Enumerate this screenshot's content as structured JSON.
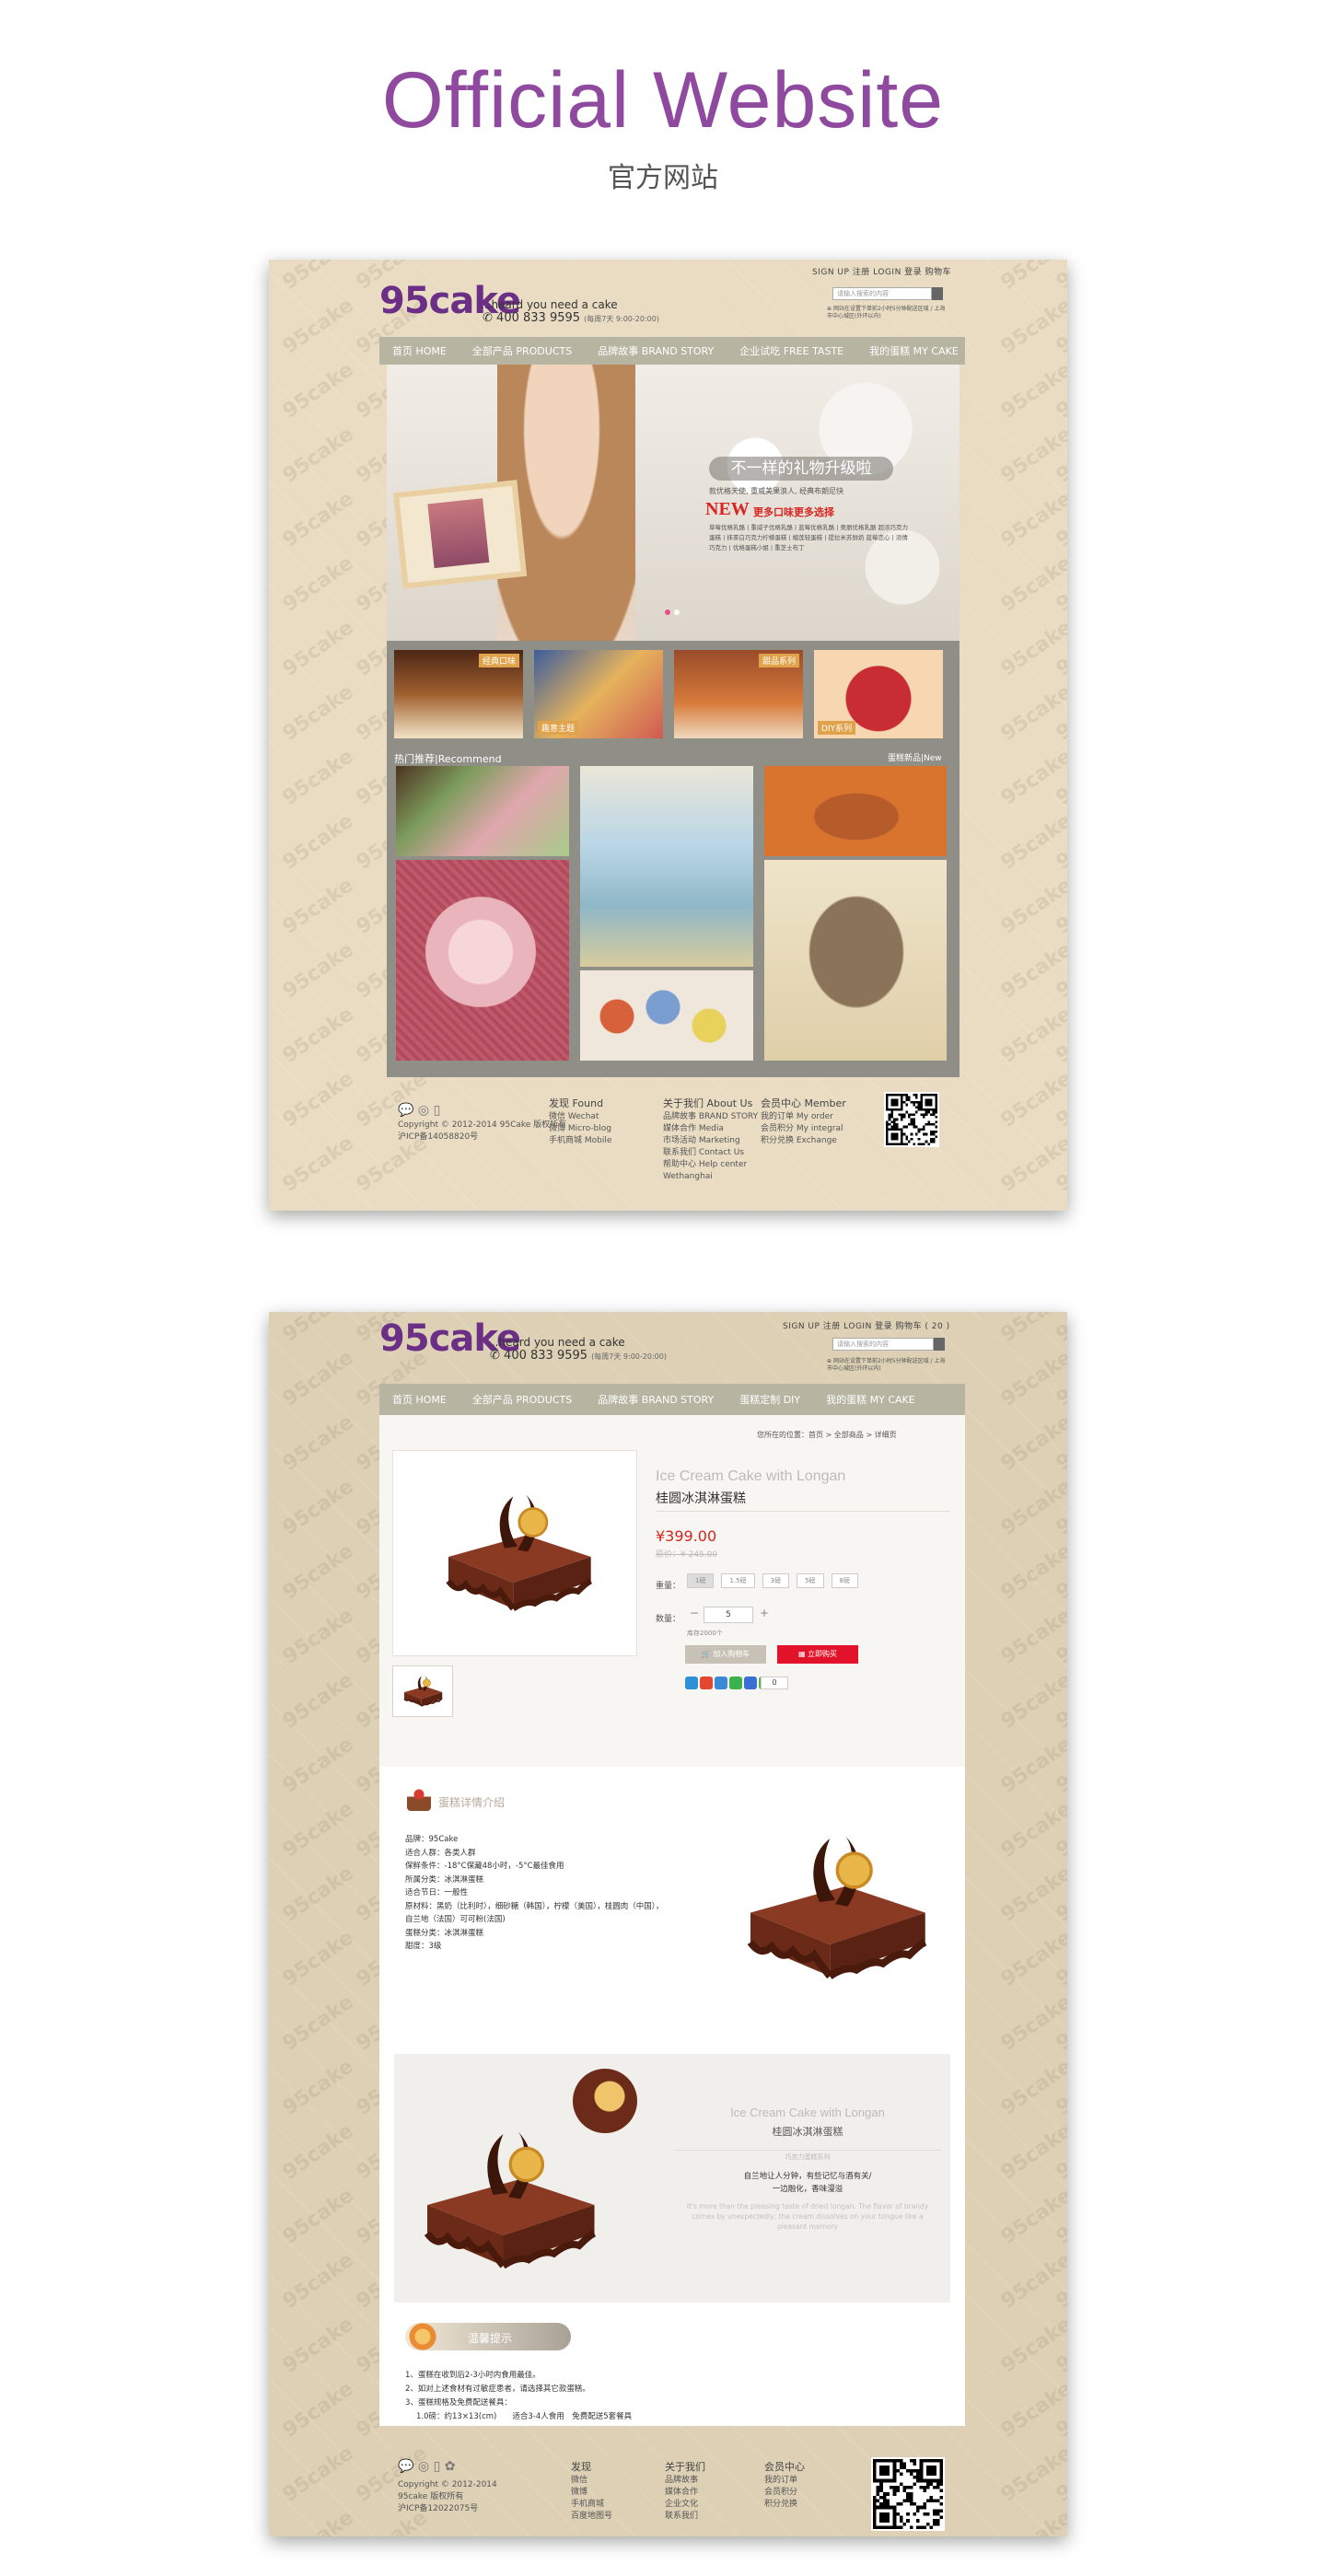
{
  "heading": {
    "title": "Official Website",
    "subtitle": "官方网站"
  },
  "site": {
    "logo": "95cake",
    "tagline": "...heard you need a cake",
    "phone": "400 833 9595",
    "phone_hours": "(每周7天 9:00-20:00)",
    "top_links": "SIGN UP 注册  LOGIN 登录  购物车",
    "search_placeholder": "请输入搜索的内容",
    "notice": "网站在设置下单前2小时5分钟配送区域 / 上海市中心城区(外环以内)"
  },
  "page1": {
    "nav": [
      "首页 HOME",
      "全部产品 PRODUCTS",
      "品牌故事 BRAND STORY",
      "企业试吃 FREE TASTE",
      "我的蛋糕 MY CAKE"
    ],
    "banner": {
      "headline": "不一样的礼物升级啦",
      "sub": "款优格天使, 重威美果浪人, 经典布朗尼快",
      "new_label": "NEW",
      "new_text": "更多口味更多选择",
      "desc": "草莓优格乳酪 | 重威子优格乳酪 | 蓝莓优格乳酪 | 奥丽优格乳酪 超浓巧克力蛋糕 | 抹茶白巧克力柠檬蛋糕 | 榴莲轻蛋糕 | 提拉米苏鲜奶 蓝莓恋心 | 浓情巧克力 | 优格蛋糕小姐 | 重芝士布丁"
    },
    "categories": [
      "经典口味",
      "趣意主题",
      "甜品系列",
      "DIY系列"
    ],
    "recommend_title": "热门推荐|Recommend",
    "recommend_more": "蛋糕新品|New",
    "footer": {
      "copyright": "Copyright © 2012-2014 95Cake 版权所有",
      "icp": "沪ICP备14058820号",
      "col1_title": "发现 Found",
      "col1": [
        "微信 Wechat",
        "微博 Micro-blog",
        "手机商城 Mobile"
      ],
      "col2_title": "关于我们 About Us",
      "col2": [
        "品牌故事 BRAND STORY",
        "媒体合作 Media",
        "市场活动 Marketing",
        "联系我们 Contact Us",
        "帮助中心 Help center",
        "Wethanghai"
      ],
      "col3_title": "会员中心 Member",
      "col3": [
        "我的订单 My order",
        "会员积分 My integral",
        "积分兑换 Exchange"
      ]
    }
  },
  "page2": {
    "top_links": "SIGN UP 注册  LOGIN 登录  购物车 ( 20 )",
    "nav": [
      "首页 HOME",
      "全部产品 PRODUCTS",
      "品牌故事 BRAND STORY",
      "蛋糕定制 DIY",
      "我的蛋糕 MY CAKE"
    ],
    "breadcrumb": "您所在的位置：首页 > 全部商品 > 详细页",
    "product": {
      "name_en": "Ice Cream Cake with Longan",
      "name_cn": "桂圆冰淇淋蛋糕",
      "price": "¥399.00",
      "old_price": "原价：¥ 245.00",
      "size_label": "重量：",
      "sizes": [
        "1磅",
        "1.5磅",
        "3磅",
        "5磅",
        "8磅"
      ],
      "qty_label": "数量：",
      "qty": "5",
      "stock": "库存2000个",
      "cart_btn": "加入购物车",
      "buy_btn": "立即购买",
      "share_count": "0"
    },
    "detail_title": "蛋糕详情介绍",
    "specs": [
      "品牌：95Cake",
      "适合人群：各类人群",
      "保鲜条件：-18°C保藏48小时，-5°C最佳食用",
      "所属分类：冰淇淋蛋糕",
      "适合节日：一般性",
      "原材料：黑奶（比利时），细砂糖（韩国），柠檬（美国），桂圆肉（中国），",
      "自兰地（法国）可可粉(法国)",
      "蛋糕分类：冰淇淋蛋糕",
      "甜度：3级"
    ],
    "feature": {
      "name_en": "Ice Cream Cake with Longan",
      "name_cn": "桂圆冰淇淋蛋糕",
      "divider": "巧克力蛋糕系列",
      "cn1": "自兰地让人分钟，有些记忆与酒有关/",
      "cn2": "一边融化，香味漫溢",
      "en": "It's more than the pleasing taste of dried longan. The flavor of brandy comes by unexpectedly; the cream dissolves on your tongue like a pleasant memory"
    },
    "tips_title": "温馨提示",
    "tips": [
      "1、蛋糕在收到后2-3小时内食用最佳。",
      "2、如对上述食材有过敏症患者，请选择其它款蛋糕。",
      "3、蛋糕规格及免费配送餐具：",
      "1.0磅：约13×13(cm)　　适合3-4人食用　免费配送5套餐具"
    ],
    "footer": {
      "copyright": "Copyright © 2012-2014",
      "brand": "95cake 版权所有",
      "icp": "沪ICP备12022075号",
      "col1_title": "发现",
      "col1": [
        "微信",
        "微博",
        "手机商城",
        "百度地图号"
      ],
      "col2_title": "关于我们",
      "col2": [
        "品牌故事",
        "媒体合作",
        "企业文化",
        "联系我们"
      ],
      "col3_title": "会员中心",
      "col3": [
        "我的订单",
        "会员积分",
        "积分兑换"
      ]
    }
  }
}
